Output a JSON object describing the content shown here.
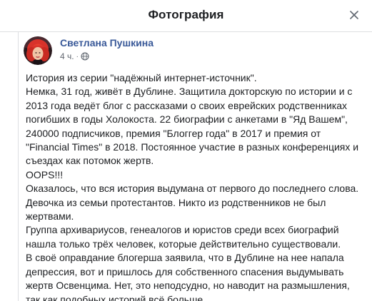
{
  "modal": {
    "title": "Фотография"
  },
  "post": {
    "author": "Светлана Пушкина",
    "time": "4 ч.",
    "separator": "·",
    "audience_icon": "globe-icon",
    "lines": [
      "История из серии \"надёжный интернет-источник\".",
      "Немка, 31 год, живёт в Дублине. Защитила докторскую по истории и с",
      "2013 года ведёт блог с рассказами о своих еврейских родственниках",
      "погибших в годы Холокоста. 22 биографии с анкетами в \"Яд Вашем\",",
      "240000 подписчиков, премия \"Блоггер года\" в 2017 и премия от",
      "\"Financial Times\" в 2018. Постоянное участие в разных конференциях и",
      "съездах как потомок жертв.",
      "OOPS!!!",
      "Оказалось, что вся история выдумана от первого до последнего слова.",
      "Девочка из семьи протестантов. Никто из родственников не был",
      "жертвами.",
      "Группа архивариусов, генеалогов и юристов среди всех биографий",
      "нашла только трёх человек, которые действительно существовали.",
      "В своё оправдание блогерша заявила, что в Дублине на нее напала",
      "депрессия, вот и пришлось для собственного спасения выдумывать",
      "жертв Освенцима. Нет, это неподсудно, но наводит на размышления,",
      "так как подобных историй всё больше."
    ]
  },
  "colors": {
    "author_link": "#385898",
    "text": "#1c1e21",
    "meta": "#616770",
    "divider": "#dddfe2"
  }
}
